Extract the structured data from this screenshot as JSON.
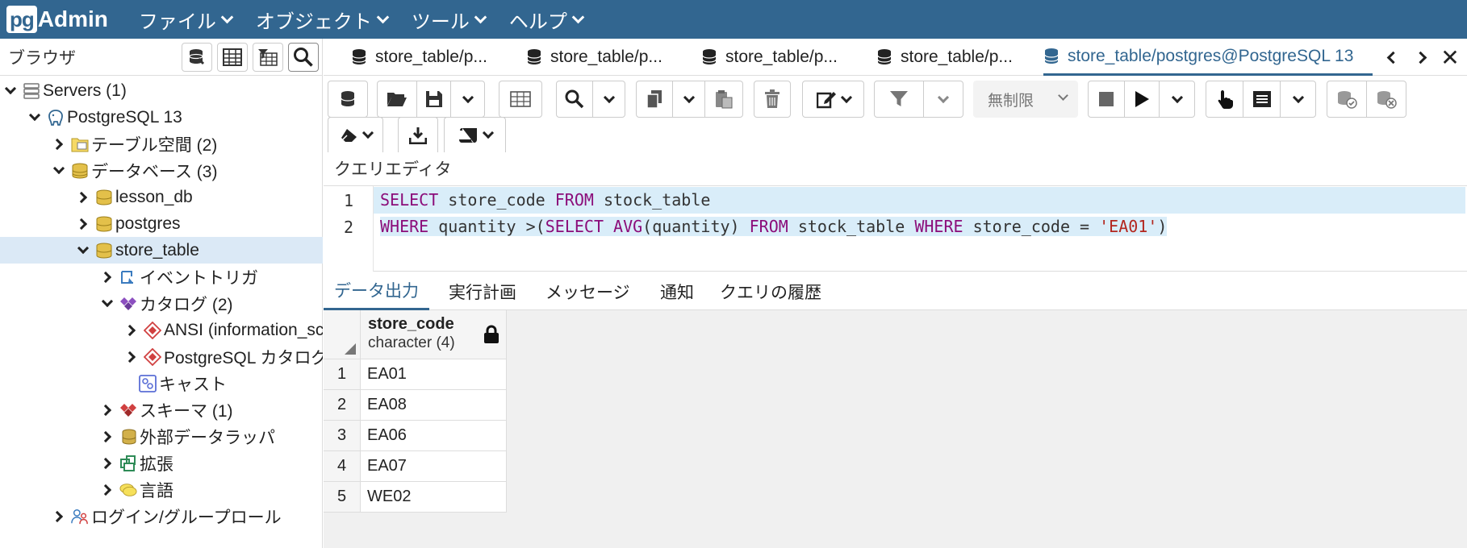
{
  "navbar": {
    "logo_pg": "pg",
    "logo_admin": "Admin",
    "menu": [
      {
        "label": "ファイル"
      },
      {
        "label": "オブジェクト"
      },
      {
        "label": "ツール"
      },
      {
        "label": "ヘルプ"
      }
    ],
    "color": "#326690"
  },
  "browser": {
    "title": "ブラウザ",
    "tree": [
      {
        "label": "Servers (1)",
        "icon": "servers-icon"
      },
      {
        "label": "PostgreSQL 13",
        "icon": "postgresql-elephant-icon"
      },
      {
        "label": "テーブル空間 (2)",
        "icon": "tablespace-icon"
      },
      {
        "label": "データベース (3)",
        "icon": "databases-icon"
      },
      {
        "label": "lesson_db",
        "icon": "database-icon"
      },
      {
        "label": "postgres",
        "icon": "database-icon"
      },
      {
        "label": "store_table",
        "icon": "database-icon"
      },
      {
        "label": "イベントトリガ",
        "icon": "event-trigger-icon"
      },
      {
        "label": "カタログ (2)",
        "icon": "catalogs-icon"
      },
      {
        "label": "ANSI (information_sc",
        "icon": "catalog-icon"
      },
      {
        "label": "PostgreSQL カタログ",
        "icon": "catalog-icon"
      },
      {
        "label": "キャスト",
        "icon": "cast-icon"
      },
      {
        "label": "スキーマ (1)",
        "icon": "schemas-icon"
      },
      {
        "label": "外部データラッパ",
        "icon": "foreign-data-wrapper-icon"
      },
      {
        "label": "拡張",
        "icon": "extension-icon"
      },
      {
        "label": "言語",
        "icon": "language-icon"
      },
      {
        "label": "ログイン/グループロール",
        "icon": "login-roles-icon"
      }
    ]
  },
  "tabs": [
    {
      "label": "store_table/p..."
    },
    {
      "label": "store_table/p..."
    },
    {
      "label": "store_table/p..."
    },
    {
      "label": "store_table/p..."
    },
    {
      "label": "store_table/postgres@PostgreSQL 13"
    }
  ],
  "toolbar": {
    "limit_label": "無制限"
  },
  "editor": {
    "section_label": "クエリエディタ",
    "line_numbers": [
      "1",
      "2"
    ],
    "line1": {
      "k1": "SELECT",
      "t1": " store_code ",
      "k2": "FROM",
      "t2": " stock_table"
    },
    "line2": {
      "k1": "WHERE",
      "t1": " quantity ",
      "p1": ">(",
      "k2": "SELECT",
      "t2": " ",
      "k3": "AVG",
      "p2": "(",
      "t3": "quantity",
      "p3": ")",
      "t4": " ",
      "k4": "FROM",
      "t5": " stock_table ",
      "k5": "WHERE",
      "t6": " store_code = ",
      "s1": "'EA01'",
      "p4": ")"
    }
  },
  "results": {
    "tabs": [
      {
        "label": "データ出力"
      },
      {
        "label": "実行計画"
      },
      {
        "label": "メッセージ"
      },
      {
        "label": "通知"
      },
      {
        "label": "クエリの履歴"
      }
    ],
    "column": {
      "name": "store_code",
      "type": "character (4)"
    },
    "rows": [
      {
        "n": "1",
        "value": "EA01"
      },
      {
        "n": "2",
        "value": "EA08"
      },
      {
        "n": "3",
        "value": "EA06"
      },
      {
        "n": "4",
        "value": "EA07"
      },
      {
        "n": "5",
        "value": "WE02"
      }
    ]
  }
}
